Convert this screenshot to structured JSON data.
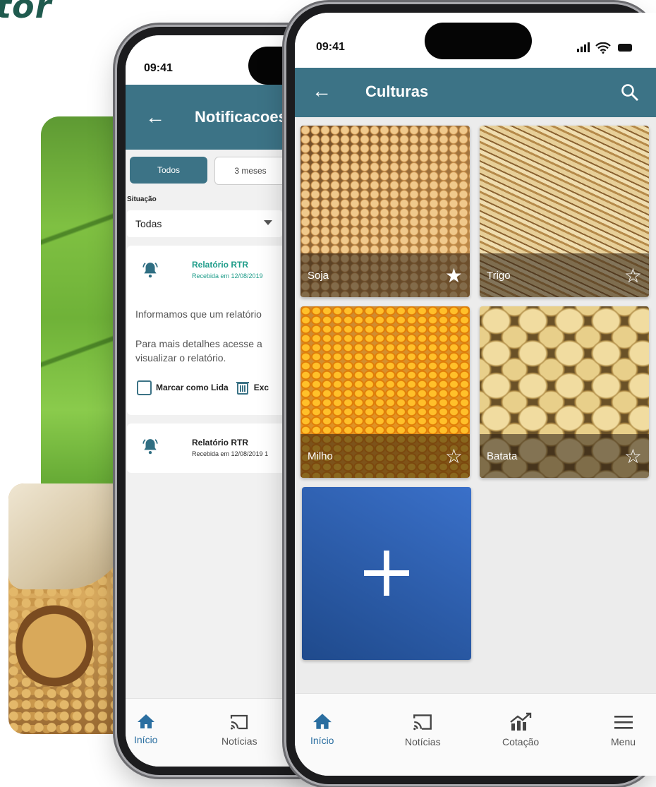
{
  "brand": {
    "text": "tor"
  },
  "notifications_screen": {
    "status_time": "09:41",
    "title": "Notificacoes",
    "filters": {
      "all": "Todos",
      "three_months": "3 meses"
    },
    "situation_label": "Situação",
    "situation_value": "Todas",
    "cards": [
      {
        "title": "Relatório RTR",
        "date": "Recebida em 12/08/2019",
        "line1": "Informamos que um relatório",
        "line2": "Para mais detalhes acesse a",
        "line3": "visualizar o relatório.",
        "mark_read": "Marcar como Lida",
        "delete": "Exc"
      },
      {
        "title": "Relatório RTR",
        "date": "Recebida em 12/08/2019 1"
      }
    ],
    "tabs": [
      {
        "label": "Início"
      },
      {
        "label": "Notícias"
      }
    ]
  },
  "cultures_screen": {
    "status_time": "09:41",
    "title": "Culturas",
    "crops": [
      {
        "name": "Soja",
        "favorite": true
      },
      {
        "name": "Trigo",
        "favorite": false
      },
      {
        "name": "Milho",
        "favorite": false
      },
      {
        "name": "Batata",
        "favorite": false
      }
    ],
    "tabs": [
      {
        "label": "Início"
      },
      {
        "label": "Notícias"
      },
      {
        "label": "Cotação"
      },
      {
        "label": "Menu"
      }
    ]
  },
  "icons": {
    "back": "arrow-left-icon",
    "search": "search-icon",
    "bell": "bell-icon",
    "trash": "trash-icon",
    "home": "home-icon",
    "news": "cast-icon",
    "quote": "chart-up-icon",
    "menu": "hamburger-icon",
    "star": "star-icon",
    "add": "plus-icon"
  },
  "colors": {
    "appbar": "#3c7386",
    "accent": "#1f9d8a",
    "active_tab": "#2a6ea0",
    "add_tile": "#2f5fb0"
  }
}
